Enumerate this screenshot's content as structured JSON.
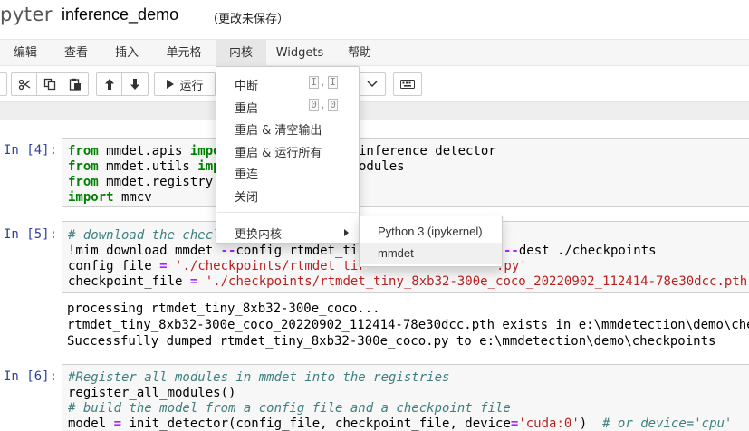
{
  "header": {
    "logo": "pyter",
    "notebook_name": "inference_demo",
    "save_status": "（更改未保存）"
  },
  "menubar": {
    "items": [
      "编辑",
      "查看",
      "插入",
      "单元格",
      "内核",
      "Widgets",
      "帮助"
    ]
  },
  "toolbar": {
    "run_label": "运行",
    "icons": [
      "fast-forward-icon",
      "cut-icon",
      "copy-icon",
      "paste-icon",
      "move-up-icon",
      "move-down-icon",
      "run-icon",
      "dropdown-caret-icon",
      "keyboard-icon"
    ]
  },
  "kernel_menu": {
    "items": [
      {
        "label": "中断",
        "keys": [
          "I",
          "I"
        ]
      },
      {
        "label": "重启",
        "keys": [
          "0",
          "0"
        ]
      },
      {
        "label": "重启 & 清空输出"
      },
      {
        "label": "重启 & 运行所有"
      },
      {
        "label": "重连"
      },
      {
        "label": "关闭"
      },
      {
        "label": "更换内核"
      }
    ],
    "submenu": [
      "Python 3 (ipykernel)",
      "mmdet"
    ]
  },
  "cells": [
    {
      "prompt": "In [4]:",
      "lines": [
        "from mmdet.apis impo",
        "inference_detector",
        "from mmdet.utils imp",
        "odules",
        "from mmdet.registry",
        "import mmcv"
      ]
    },
    {
      "prompt": "In [5]:",
      "lines": [
        "# download the checl",
        "!mim download mmdet --config rtmdet_tir",
        "--dest ./checkpoints",
        "config_file = './checkpoints/rtmdet_tir",
        ".py'",
        "checkpoint_file = './checkpoints/rtmdet_tiny_8xb32-300e_coco_20220902_112414-78e30dcc.pth"
      ],
      "output": [
        "processing rtmdet_tiny_8xb32-300e_coco...",
        "rtmdet_tiny_8xb32-300e_coco_20220902_112414-78e30dcc.pth exists in e:\\mmdetection\\demo\\che",
        "Successfully dumped rtmdet_tiny_8xb32-300e_coco.py to e:\\mmdetection\\demo\\checkpoints"
      ]
    },
    {
      "prompt": "In [6]:",
      "lines": [
        "#Register all modules in mmdet into the registries",
        "register_all_modules()",
        "# build the model from a config file and a checkpoint file",
        "model = init_detector(config_file, checkpoint_file, device='cuda:0')  # or device='cpu'"
      ]
    }
  ]
}
